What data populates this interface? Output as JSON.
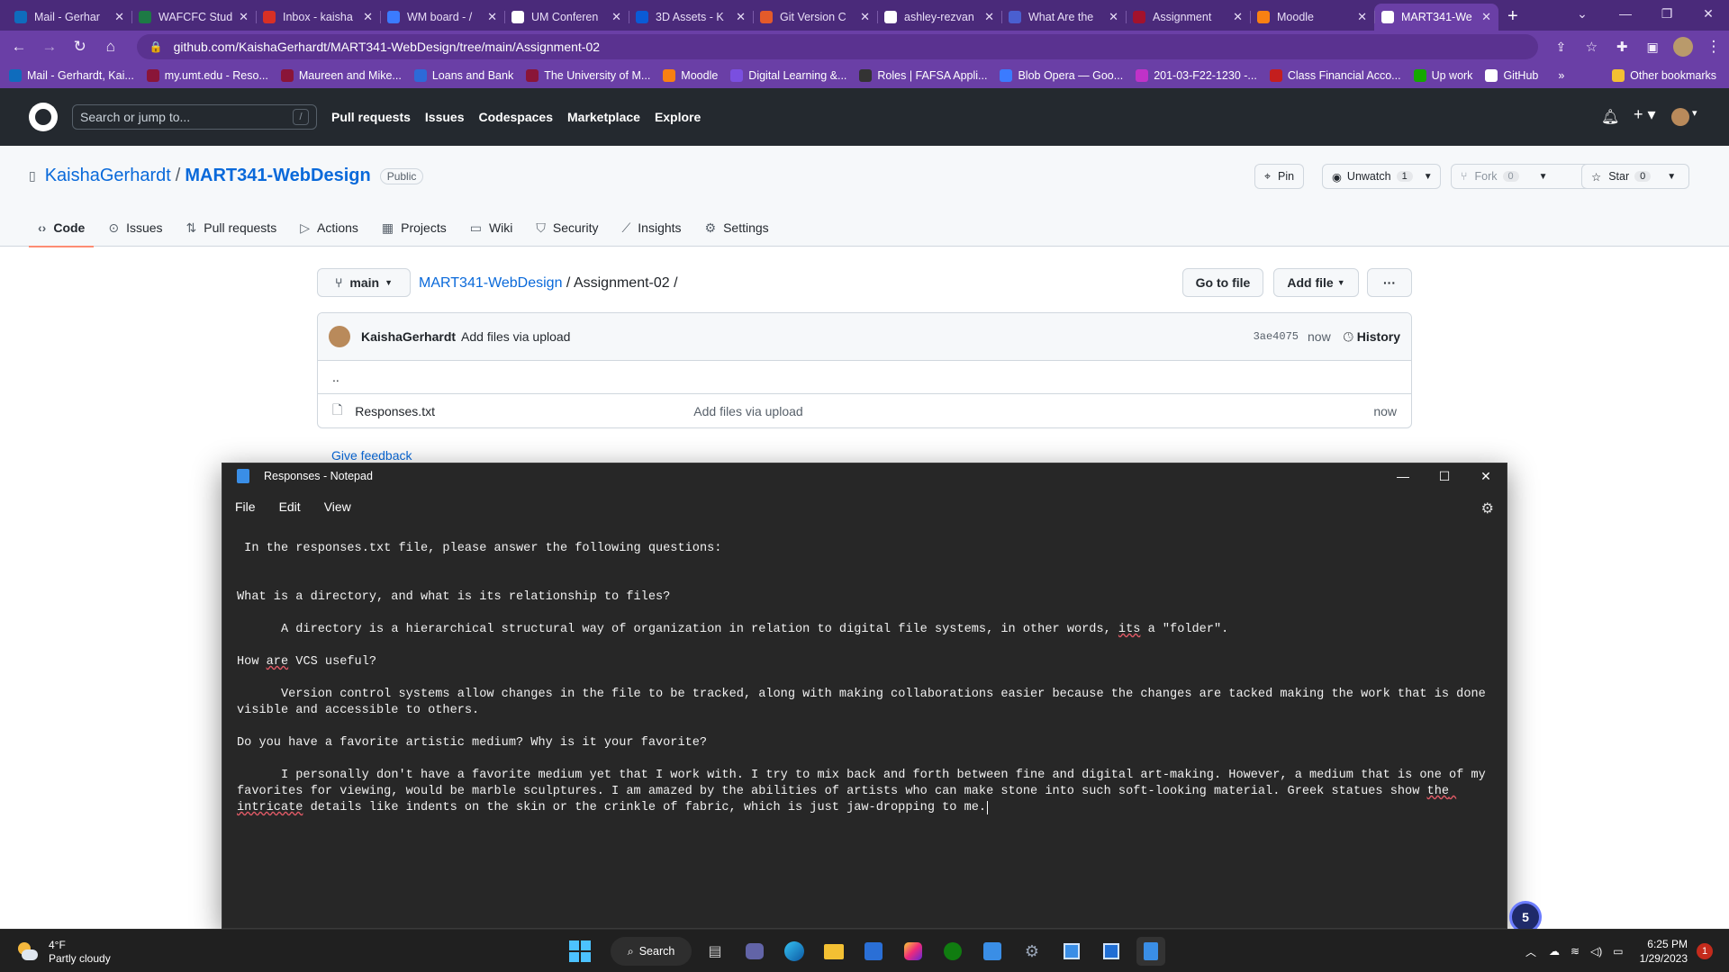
{
  "browser": {
    "tabs": [
      {
        "title": "Mail - Gerhar",
        "color": "#0f6cbd"
      },
      {
        "title": "WAFCFC Stud",
        "color": "#1d7a45"
      },
      {
        "title": "Inbox - kaisha",
        "color": "#d93025"
      },
      {
        "title": "WM board - /",
        "color": "#3b7bff"
      },
      {
        "title": "UM Conferen",
        "color": "#ffffff"
      },
      {
        "title": "3D Assets - K",
        "color": "#0a5bd6"
      },
      {
        "title": "Git Version C",
        "color": "#e45a2a"
      },
      {
        "title": "ashley-rezvan",
        "color": "#ffffff"
      },
      {
        "title": "What Are the",
        "color": "#4a5fd0"
      },
      {
        "title": "Assignment",
        "color": "#a3122c"
      },
      {
        "title": "Moodle",
        "color": "#f98012"
      },
      {
        "title": "MART341-We",
        "color": "#ffffff",
        "active": true
      }
    ],
    "url": "github.com/KaishaGerhardt/MART341-WebDesign/tree/main/Assignment-02",
    "bookmarks": [
      {
        "label": "Mail - Gerhardt, Kai...",
        "color": "#0f6cbd"
      },
      {
        "label": "my.umt.edu - Reso...",
        "color": "#8a1538"
      },
      {
        "label": "Maureen and Mike...",
        "color": "#8a1538"
      },
      {
        "label": "Loans and Bank",
        "color": "#2d6ad8"
      },
      {
        "label": "The University of M...",
        "color": "#8a1538"
      },
      {
        "label": "Moodle",
        "color": "#f98012"
      },
      {
        "label": "Digital Learning &...",
        "color": "#7a4fe0"
      },
      {
        "label": "Roles | FAFSA Appli...",
        "color": "#333333"
      },
      {
        "label": "Blob Opera — Goo...",
        "color": "#3b7bff"
      },
      {
        "label": "201-03-F22-1230 -...",
        "color": "#c032c8"
      },
      {
        "label": "Class Financial Acco...",
        "color": "#c41e1e"
      },
      {
        "label": "Up work",
        "color": "#14a800"
      },
      {
        "label": "GitHub",
        "color": "#ffffff"
      }
    ],
    "more_bookmarks": "»",
    "other_bookmarks": "Other bookmarks"
  },
  "github": {
    "search_placeholder": "Search or jump to...",
    "search_key": "/",
    "nav": [
      "Pull requests",
      "Issues",
      "Codespaces",
      "Marketplace",
      "Explore"
    ],
    "repo_owner": "KaishaGerhardt",
    "repo_sep": "/",
    "repo_name": "MART341-WebDesign",
    "visibility": "Public",
    "pin": "Pin",
    "unwatch": "Unwatch",
    "unwatch_count": "1",
    "fork": "Fork",
    "fork_count": "0",
    "star": "Star",
    "star_count": "0",
    "tabs": [
      "Code",
      "Issues",
      "Pull requests",
      "Actions",
      "Projects",
      "Wiki",
      "Security",
      "Insights",
      "Settings"
    ],
    "branch": "main",
    "crumb_repo": "MART341-WebDesign",
    "crumb_rest": " / Assignment-02 /",
    "go_to_file": "Go to file",
    "add_file": "Add file",
    "more": "···",
    "commit_author": "KaishaGerhardt",
    "commit_message": "Add files via upload",
    "commit_hash": "3ae4075",
    "commit_time": "now",
    "history": "History",
    "parent_dir": "..",
    "files": [
      {
        "name": "Responses.txt",
        "message": "Add files via upload",
        "time": "now"
      }
    ],
    "feedback": "Give feedback"
  },
  "notepad": {
    "title": "Responses - Notepad",
    "menu": [
      "File",
      "Edit",
      "View"
    ],
    "lines": {
      "intro": " In the responses.txt file, please answer the following questions:",
      "q1": "What is a directory, and what is its relationship to files?",
      "a1_pre": "      A directory is a hierarchical structural way of organization in relation to digital file systems, in other words, ",
      "a1_ul": "its",
      "a1_post": " a \"folder\".",
      "q2_pre": "How ",
      "q2_ul": "are",
      "q2_post": " VCS useful?",
      "a2": "      Version control systems allow changes in the file to be tracked, along with making collaborations easier because the changes are tacked making the work that is done visible and accessible to others.",
      "q3": "Do you have a favorite artistic medium? Why is it your favorite?",
      "a3_pre": "      I personally don't have a favorite medium yet that I work with. I try to mix back and forth between fine and digital art-making. However, a medium that is one of my favorites for viewing, would be marble sculptures. I am amazed by the abilities of artists who can make stone into such soft-looking material. Greek statues show ",
      "a3_ul": "the intricate",
      "a3_post": " details like indents on the skin or the crinkle of fabric, which is just jaw-dropping to me."
    }
  },
  "floating_badge": "5",
  "taskbar": {
    "temperature": "4°F",
    "weather": "Partly cloudy",
    "search": "Search",
    "time": "6:25 PM",
    "date": "1/29/2023",
    "notifications": "1"
  }
}
